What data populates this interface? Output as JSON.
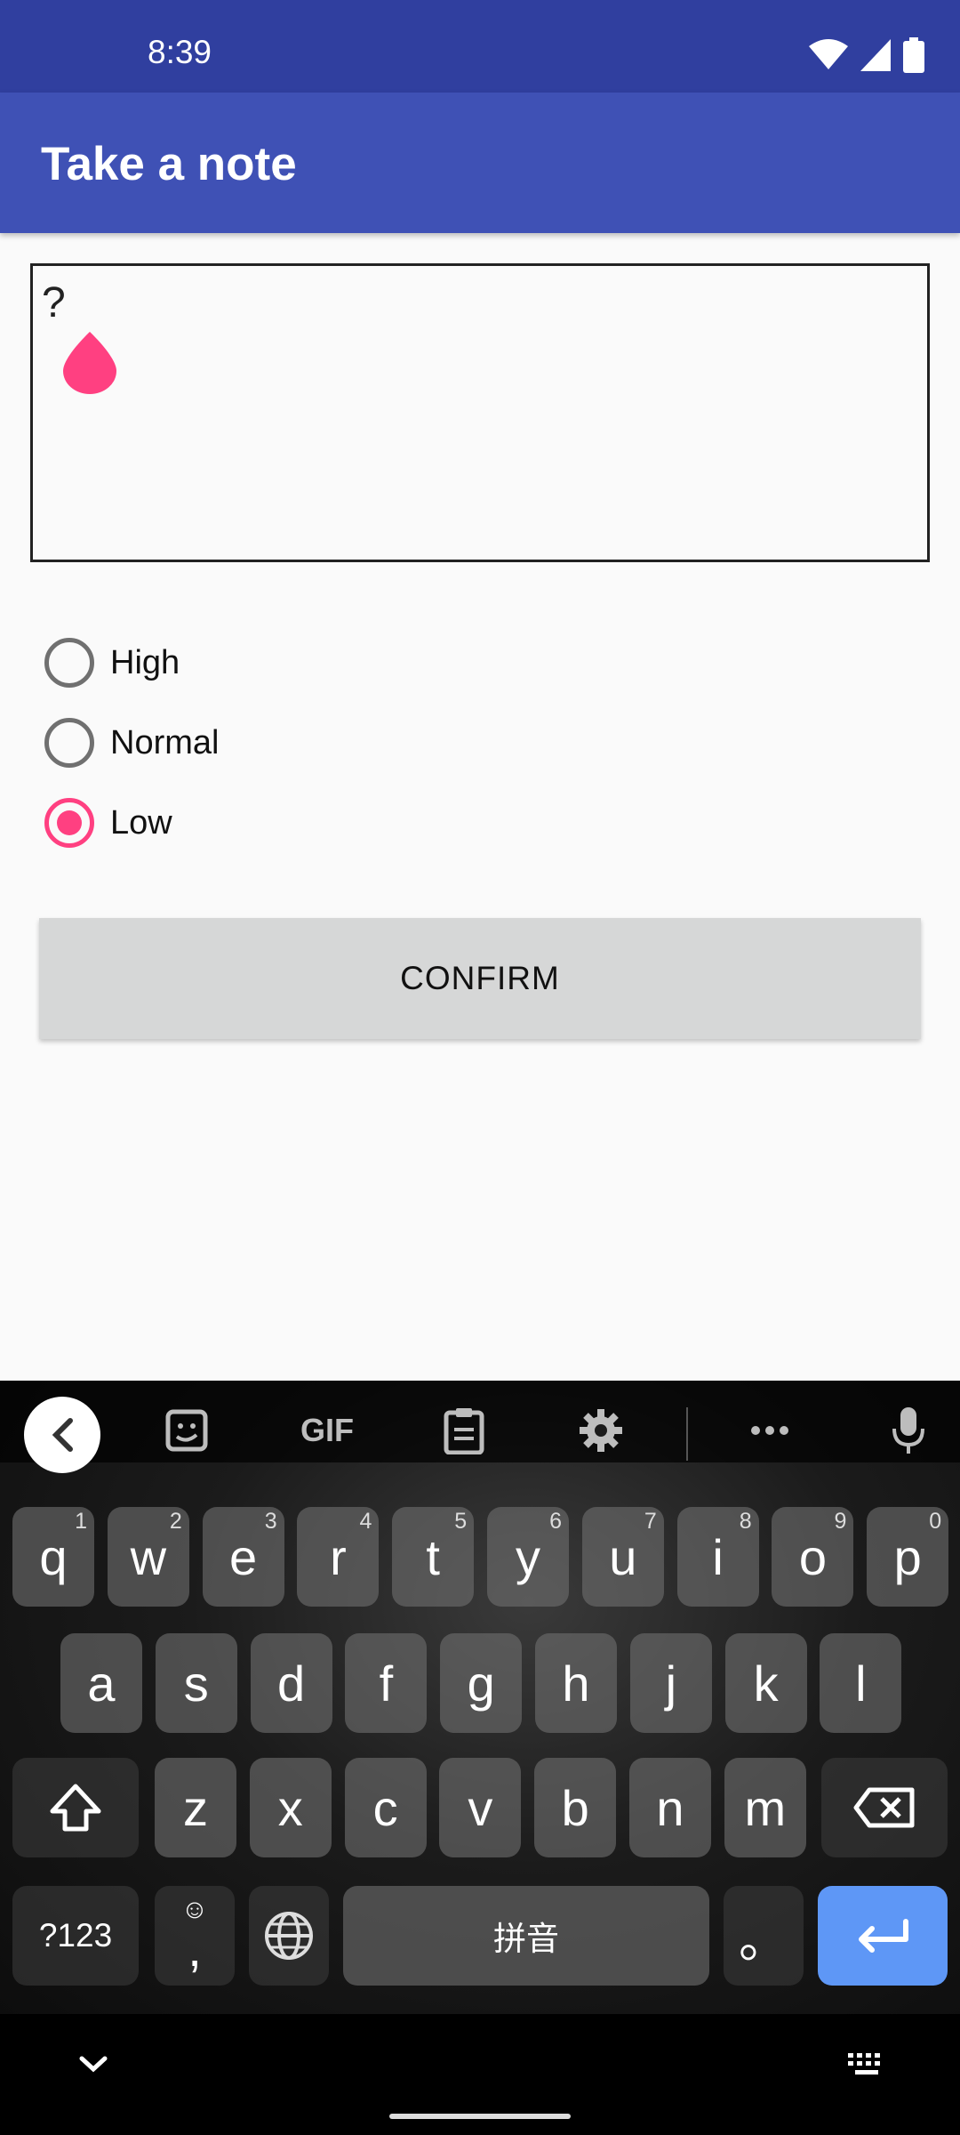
{
  "status": {
    "time": "8:39"
  },
  "app_bar": {
    "title": "Take a note"
  },
  "note": {
    "text": "?"
  },
  "priority": {
    "options": [
      "High",
      "Normal",
      "Low"
    ],
    "selected": "Low"
  },
  "confirm_label": "CONFIRM",
  "keyboard": {
    "toolbar": {
      "gif_label": "GIF"
    },
    "row1": [
      {
        "k": "q",
        "h": "1"
      },
      {
        "k": "w",
        "h": "2"
      },
      {
        "k": "e",
        "h": "3"
      },
      {
        "k": "r",
        "h": "4"
      },
      {
        "k": "t",
        "h": "5"
      },
      {
        "k": "y",
        "h": "6"
      },
      {
        "k": "u",
        "h": "7"
      },
      {
        "k": "i",
        "h": "8"
      },
      {
        "k": "o",
        "h": "9"
      },
      {
        "k": "p",
        "h": "0"
      }
    ],
    "row2": [
      "a",
      "s",
      "d",
      "f",
      "g",
      "h",
      "j",
      "k",
      "l"
    ],
    "row3": [
      "z",
      "x",
      "c",
      "v",
      "b",
      "n",
      "m"
    ],
    "symbols_label": "?123",
    "comma_label": ",",
    "space_label": "拼音",
    "period_label": "。"
  },
  "colors": {
    "status_bar": "#303f9f",
    "app_bar": "#3f51b5",
    "accent": "#ff4081",
    "enter_key": "#5e97f6"
  }
}
